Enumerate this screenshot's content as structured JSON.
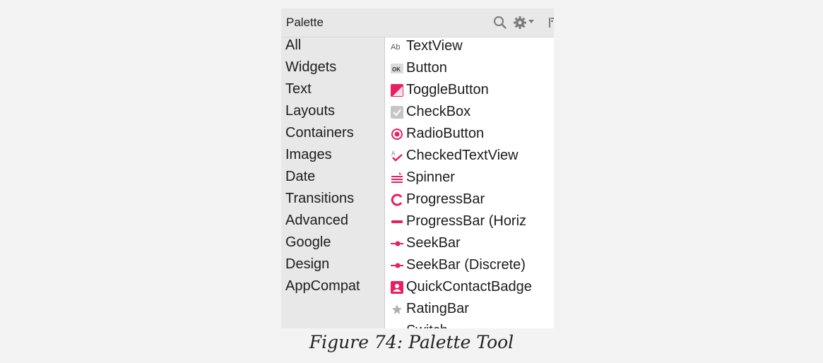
{
  "palette": {
    "title": "Palette",
    "header_icons": [
      "search-icon",
      "gear-icon",
      "chevron-down-icon",
      "layout-toggle-icon"
    ],
    "accent_color": "#e91e63",
    "categories": [
      "All",
      "Widgets",
      "Text",
      "Layouts",
      "Containers",
      "Images",
      "Date",
      "Transitions",
      "Advanced",
      "Google",
      "Design",
      "AppCompat"
    ],
    "components": [
      {
        "label": "TextView",
        "icon": "text-ab-icon"
      },
      {
        "label": "Button",
        "icon": "ok-button-icon"
      },
      {
        "label": "ToggleButton",
        "icon": "toggle-button-icon"
      },
      {
        "label": "CheckBox",
        "icon": "checkbox-icon"
      },
      {
        "label": "RadioButton",
        "icon": "radio-button-icon"
      },
      {
        "label": "CheckedTextView",
        "icon": "checked-text-icon"
      },
      {
        "label": "Spinner",
        "icon": "spinner-icon"
      },
      {
        "label": "ProgressBar",
        "icon": "progress-circle-icon"
      },
      {
        "label": "ProgressBar (Horiz",
        "icon": "progress-horizontal-icon"
      },
      {
        "label": "SeekBar",
        "icon": "seekbar-icon"
      },
      {
        "label": "SeekBar (Discrete)",
        "icon": "seekbar-discrete-icon"
      },
      {
        "label": "QuickContactBadge",
        "icon": "contact-badge-icon"
      },
      {
        "label": "RatingBar",
        "icon": "star-icon"
      },
      {
        "label": "Switch",
        "icon": "switch-icon"
      }
    ]
  },
  "caption": "Figure 74: Palette Tool"
}
